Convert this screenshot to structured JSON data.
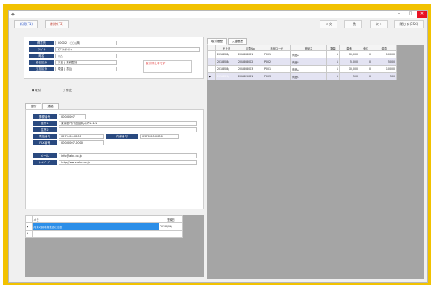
{
  "window": {
    "minimize": "–",
    "maximize": "□",
    "close": "✕"
  },
  "toolbar": {
    "btn1": "新規(F1)",
    "btn2": "削除(F3)",
    "nav_prev": "< 戻",
    "nav_list": "一覧",
    "nav_next": "次 >",
    "nav_close": "閉じる(ESC)"
  },
  "customer": {
    "rows": [
      {
        "label": "得意先",
        "value": "00002　○○△商"
      },
      {
        "label": "ﾌﾘｶﾞﾅ",
        "value": "ｶﾌﾞｼｷｶﾞｲｼｬ"
      },
      {
        "label": "略名",
        "value": "○△"
      },
      {
        "label": "締日区分",
        "value": "末日 | 末締翌月"
      },
      {
        "label": "支払区分",
        "value": "現金 | 振込"
      }
    ],
    "warning": "取引停止中です"
  },
  "radio": {
    "opt1": "取引",
    "opt2": "停止"
  },
  "tabs": {
    "tab1": "住所",
    "tab2": "連絡"
  },
  "address": {
    "zip_label": "郵便番号",
    "zip_value": "000-0007",
    "addr1_label": "住所1",
    "addr1_value": "東京都千代田区丸の内1-1-1",
    "addr2_label": "住所2",
    "addr2_value": "",
    "tel_label": "電話番号",
    "tel_value": "0570-00-0000",
    "tel2_label": "内線番号",
    "tel2_value": "0570-00-0000",
    "fax_label": "FAX番号",
    "fax_value": "000-0007-0000",
    "mail_label": "メール",
    "mail_value": "info@abc.co.jp",
    "url_label": "ﾎｰﾑﾍﾟｰｼﾞ",
    "url_value": "http://www.abc.co.jp"
  },
  "notes_grid": {
    "headers": [
      "",
      "メモ",
      "登録日"
    ],
    "rows": [
      {
        "mark": "▶",
        "text": "月末の請求書発送に注意",
        "date": "2018/09/"
      },
      {
        "mark": "*",
        "text": "",
        "date": ""
      }
    ]
  },
  "right_tabs": {
    "tab1": "取引履歴",
    "tab2": "入金履歴"
  },
  "sales_grid": {
    "headers": [
      "",
      "売上日",
      "伝票No",
      "商品コード",
      "商品名",
      "数量",
      "単価",
      "値引",
      "金額"
    ],
    "rows": [
      {
        "mark": "",
        "date": "2018/08/",
        "slip": "201808001",
        "code": "P001",
        "name": "商品A",
        "qty": "1",
        "price": "10,000",
        "disc": "0",
        "amount": "10,000",
        "alt": false,
        "sel": false
      },
      {
        "mark": "",
        "date": "2018/08/",
        "slip": "201808002",
        "code": "P002",
        "name": "商品B",
        "qty": "1",
        "price": "5,000",
        "disc": "0",
        "amount": "5,000",
        "alt": true,
        "sel": false
      },
      {
        "mark": "",
        "date": "2018/08/",
        "slip": "201808003",
        "code": "P001",
        "name": "商品A",
        "qty": "1",
        "price": "10,000",
        "disc": "0",
        "amount": "10,000",
        "alt": false,
        "sel": false
      },
      {
        "mark": "▶",
        "date": "2018/09/",
        "slip": "201809001",
        "code": "P003",
        "name": "商品C",
        "qty": "1",
        "price": "500",
        "disc": "0",
        "amount": "500",
        "alt": true,
        "sel": true
      }
    ]
  }
}
